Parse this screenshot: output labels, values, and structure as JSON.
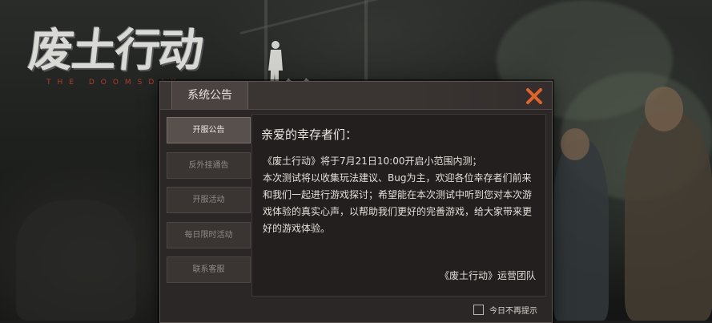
{
  "game": {
    "logo_title": "废土行动",
    "logo_subtitle": "THE DOOMSDAY"
  },
  "dialog": {
    "title": "系统公告",
    "close_icon": "close-x-icon",
    "accent_color": "#e0632b",
    "tabs": [
      {
        "label": "开服公告",
        "active": true
      },
      {
        "label": "反外挂通告",
        "active": false
      },
      {
        "label": "开服活动",
        "active": false
      },
      {
        "label": "每日限时活动",
        "active": false
      },
      {
        "label": "联系客服",
        "active": false
      }
    ],
    "announcement": {
      "greeting": "亲爱的幸存者们：",
      "paragraphs": [
        "《废土行动》将于7月21日10:00开启小范围内测；",
        "本次测试将以收集玩法建议、Bug为主，欢迎各位幸存者们前来和我们一起进行游戏探讨；希望能在本次测试中听到您对本次游戏体验的真实心声，以帮助我们更好的完善游戏，给大家带来更好的游戏体验。"
      ],
      "signature": "《废土行动》运营团队"
    },
    "no_remind_today": {
      "label": "今日不再提示",
      "checked": false
    }
  }
}
